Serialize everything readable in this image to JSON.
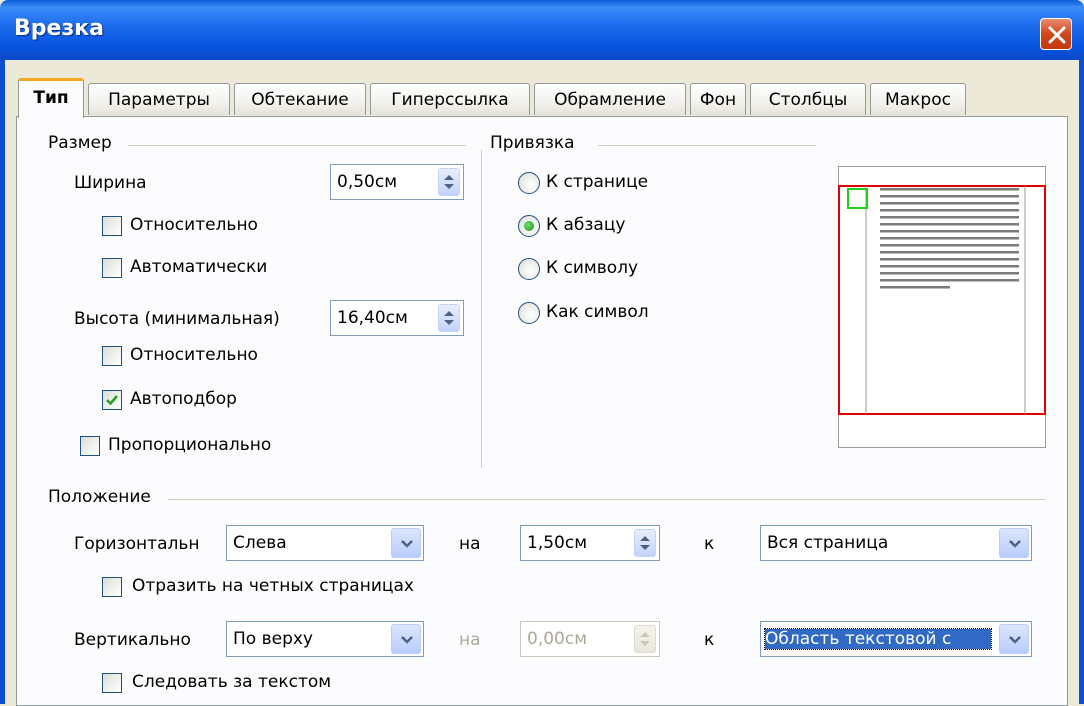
{
  "window": {
    "title": "Врезка"
  },
  "tabs": [
    {
      "label": "Тип"
    },
    {
      "label": "Параметры"
    },
    {
      "label": "Обтекание"
    },
    {
      "label": "Гиперссылка"
    },
    {
      "label": "Обрамление"
    },
    {
      "label": "Фон"
    },
    {
      "label": "Столбцы"
    },
    {
      "label": "Макрос"
    }
  ],
  "size": {
    "header": "Размер",
    "width_label": "Ширина",
    "width_value": "0,50см",
    "relative1": "Относительно",
    "automatic": "Автоматически",
    "height_label": "Высота (минимальная)",
    "height_value": "16,40см",
    "relative2": "Относительно",
    "autofit": "Автоподбор",
    "proportional": "Пропорционально"
  },
  "anchor": {
    "header": "Привязка",
    "to_page": "К странице",
    "to_paragraph": "К абзацу",
    "to_char": "К символу",
    "as_char": "Как символ",
    "selected": "to_paragraph"
  },
  "position": {
    "header": "Положение",
    "horizontal_label": "Горизонтальн",
    "horizontal_value": "Слева",
    "h_by_label": "на",
    "h_by_value": "1,50см",
    "h_to_label": "к",
    "h_to_value": "Вся страница",
    "mirror": "Отразить на четных страницах",
    "vertical_label": "Вертикально",
    "vertical_value": "По верху",
    "v_by_label": "на",
    "v_by_value": "0,00см",
    "v_to_label": "к",
    "v_to_value": "Область текстовой с",
    "follow": "Следовать за текстом"
  },
  "checks": {
    "relative1": false,
    "automatic": false,
    "relative2": false,
    "autofit": true,
    "proportional": false,
    "mirror": false,
    "follow": false
  },
  "colors": {
    "titlebar": "#0a5ed8",
    "accent_tab": "#f5a623",
    "preview_frame": "#e00000",
    "preview_anchor": "#22cc22"
  }
}
